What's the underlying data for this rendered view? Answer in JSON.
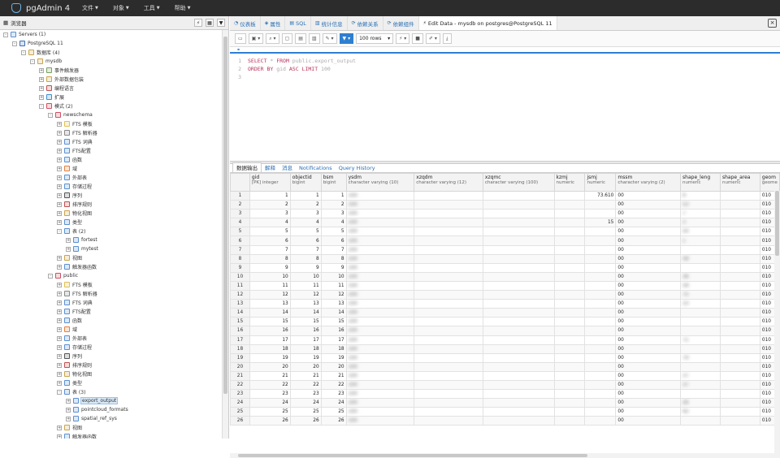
{
  "app": {
    "title": "pgAdmin 4"
  },
  "menu": [
    {
      "label": "文件"
    },
    {
      "label": "对象"
    },
    {
      "label": "工具"
    },
    {
      "label": "帮助"
    }
  ],
  "browser": {
    "title": "浏览器"
  },
  "tree": [
    {
      "level": 0,
      "label": "Servers (1)",
      "color": "#5a8fd0",
      "toggle": "-"
    },
    {
      "level": 1,
      "label": "PostgreSQL 11",
      "color": "#3d6fb5",
      "toggle": "-"
    },
    {
      "level": 2,
      "label": "数据库 (4)",
      "color": "#c9a44a",
      "toggle": "-"
    },
    {
      "level": 3,
      "label": "mysdb",
      "color": "#c9a44a",
      "toggle": "-"
    },
    {
      "level": 4,
      "label": "事件触发器",
      "color": "#7aa060",
      "toggle": "+"
    },
    {
      "level": 4,
      "label": "外部数据包装",
      "color": "#c9a44a",
      "toggle": "+"
    },
    {
      "level": 4,
      "label": "编程语言",
      "color": "#c05050",
      "toggle": "+"
    },
    {
      "level": 4,
      "label": "扩展",
      "color": "#3a8fd0",
      "toggle": "+"
    },
    {
      "level": 4,
      "label": "模式 (2)",
      "color": "#d05060",
      "toggle": "-"
    },
    {
      "level": 5,
      "label": "newschema",
      "color": "#d05060",
      "toggle": "-"
    },
    {
      "level": 6,
      "label": "FTS 模板",
      "color": "#e0c050",
      "toggle": "+"
    },
    {
      "level": 6,
      "label": "FTS 解析器",
      "color": "#888888",
      "toggle": "+"
    },
    {
      "level": 6,
      "label": "FTS 词典",
      "color": "#5a8fd0",
      "toggle": "+"
    },
    {
      "level": 6,
      "label": "FTS配置",
      "color": "#5a8fd0",
      "toggle": "+"
    },
    {
      "level": 6,
      "label": "函数",
      "color": "#5a8fd0",
      "toggle": "+"
    },
    {
      "level": 6,
      "label": "域",
      "color": "#e08040",
      "toggle": "+"
    },
    {
      "level": 6,
      "label": "外部表",
      "color": "#5a8fd0",
      "toggle": "+"
    },
    {
      "level": 6,
      "label": "存储过程",
      "color": "#5a8fd0",
      "toggle": "+"
    },
    {
      "level": 6,
      "label": "序列",
      "color": "#555555",
      "toggle": "+"
    },
    {
      "level": 6,
      "label": "排序规则",
      "color": "#c05050",
      "toggle": "+"
    },
    {
      "level": 6,
      "label": "物化视图",
      "color": "#c9a44a",
      "toggle": "+"
    },
    {
      "level": 6,
      "label": "类型",
      "color": "#5a8fd0",
      "toggle": "+"
    },
    {
      "level": 6,
      "label": "表 (2)",
      "color": "#5a8fd0",
      "toggle": "-"
    },
    {
      "level": 7,
      "label": "fortest",
      "color": "#5a8fd0",
      "toggle": "+"
    },
    {
      "level": 7,
      "label": "mytest",
      "color": "#5a8fd0",
      "toggle": "+"
    },
    {
      "level": 6,
      "label": "视图",
      "color": "#c9a44a",
      "toggle": "+"
    },
    {
      "level": 6,
      "label": "触发器函数",
      "color": "#5a8fd0",
      "toggle": "+"
    },
    {
      "level": 5,
      "label": "public",
      "color": "#d05060",
      "toggle": "-"
    },
    {
      "level": 6,
      "label": "FTS 模板",
      "color": "#e0c050",
      "toggle": "+"
    },
    {
      "level": 6,
      "label": "FTS 解析器",
      "color": "#888888",
      "toggle": "+"
    },
    {
      "level": 6,
      "label": "FTS 词典",
      "color": "#5a8fd0",
      "toggle": "+"
    },
    {
      "level": 6,
      "label": "FTS配置",
      "color": "#5a8fd0",
      "toggle": "+"
    },
    {
      "level": 6,
      "label": "函数",
      "color": "#5a8fd0",
      "toggle": "+"
    },
    {
      "level": 6,
      "label": "域",
      "color": "#e08040",
      "toggle": "+"
    },
    {
      "level": 6,
      "label": "外部表",
      "color": "#5a8fd0",
      "toggle": "+"
    },
    {
      "level": 6,
      "label": "存储过程",
      "color": "#5a8fd0",
      "toggle": "+"
    },
    {
      "level": 6,
      "label": "序列",
      "color": "#555555",
      "toggle": "+"
    },
    {
      "level": 6,
      "label": "排序规则",
      "color": "#c05050",
      "toggle": "+"
    },
    {
      "level": 6,
      "label": "物化视图",
      "color": "#c9a44a",
      "toggle": "+"
    },
    {
      "level": 6,
      "label": "类型",
      "color": "#5a8fd0",
      "toggle": "+"
    },
    {
      "level": 6,
      "label": "表 (3)",
      "color": "#5a8fd0",
      "toggle": "-"
    },
    {
      "level": 7,
      "label": "export_output",
      "color": "#5a8fd0",
      "toggle": "+",
      "selected": true
    },
    {
      "level": 7,
      "label": "pointcloud_formats",
      "color": "#5a8fd0",
      "toggle": "+"
    },
    {
      "level": 7,
      "label": "spatial_ref_sys",
      "color": "#5a8fd0",
      "toggle": "+"
    },
    {
      "level": 6,
      "label": "视图",
      "color": "#c9a44a",
      "toggle": "+"
    },
    {
      "level": 6,
      "label": "触发器函数",
      "color": "#5a8fd0",
      "toggle": "+"
    }
  ],
  "tabs": [
    {
      "label": "仪表板",
      "icon": "◔"
    },
    {
      "label": "属性",
      "icon": "◈"
    },
    {
      "label": "SQL",
      "icon": "▤"
    },
    {
      "label": "统计信息",
      "icon": "▥"
    },
    {
      "label": "依赖关系",
      "icon": "⟳"
    },
    {
      "label": "依赖组件",
      "icon": "⟳"
    },
    {
      "label": "Edit Data - mysdb on postgres@PostgreSQL 11",
      "icon": "⚡",
      "active": true
    }
  ],
  "toolbar": {
    "rows_select": "100 rows"
  },
  "editor": {
    "lines": [
      {
        "n": "1",
        "kw1": "SELECT",
        "t1": " * ",
        "kw2": "FROM",
        "t2": " public.export_output"
      },
      {
        "n": "2",
        "kw1": "ORDER BY",
        "t1": " gid ",
        "kw2": "ASC LIMIT",
        "t2": " 100"
      },
      {
        "n": "3",
        "kw1": "",
        "t1": "",
        "kw2": "",
        "t2": ""
      }
    ]
  },
  "result_tabs": [
    {
      "label": "数据输出",
      "active": true
    },
    {
      "label": "解释"
    },
    {
      "label": "消息"
    },
    {
      "label": "Notifications"
    },
    {
      "label": "Query History"
    }
  ],
  "grid": {
    "columns": [
      {
        "name": "gid",
        "type": "[PK] integer",
        "w": 50
      },
      {
        "name": "objectid",
        "type": "bigint",
        "w": 38
      },
      {
        "name": "bsm",
        "type": "bigint",
        "w": 31
      },
      {
        "name": "ysdm",
        "type": "character varying (10)",
        "w": 84
      },
      {
        "name": "xzqdm",
        "type": "character varying (12)",
        "w": 85
      },
      {
        "name": "xzqmc",
        "type": "character varying (100)",
        "w": 88
      },
      {
        "name": "kzmj",
        "type": "numeric",
        "w": 38
      },
      {
        "name": "jsmj",
        "type": "numeric",
        "w": 38
      },
      {
        "name": "mssm",
        "type": "character varying (2)",
        "w": 80
      },
      {
        "name": "shape_leng",
        "type": "numeric",
        "w": 49
      },
      {
        "name": "shape_area",
        "type": "numeric",
        "w": 49
      },
      {
        "name": "geom",
        "type": "geome",
        "w": 20
      }
    ],
    "rows": [
      [
        "1",
        "1",
        "1",
        "100",
        "",
        "",
        "",
        "73.610",
        "00",
        "9",
        "",
        "010"
      ],
      [
        "2",
        "2",
        "2",
        "100",
        "",
        "",
        "",
        "",
        "00",
        "53",
        "",
        "010"
      ],
      [
        "3",
        "3",
        "3",
        "100",
        "",
        "",
        "",
        "",
        "00",
        "7",
        "",
        "010"
      ],
      [
        "4",
        "4",
        "4",
        "100",
        "",
        "",
        "",
        "15",
        "00",
        "3",
        "",
        "010"
      ],
      [
        "5",
        "5",
        "5",
        "100",
        "",
        "",
        "",
        "",
        "00",
        "50",
        "",
        "010"
      ],
      [
        "6",
        "6",
        "6",
        "100",
        "",
        "",
        "",
        "",
        "00",
        "1",
        "",
        "010"
      ],
      [
        "7",
        "7",
        "7",
        "100",
        "",
        "",
        "",
        "",
        "00",
        "",
        "",
        "010"
      ],
      [
        "8",
        "8",
        "8",
        "100",
        "",
        "",
        "",
        "",
        "00",
        "58",
        "",
        "010"
      ],
      [
        "9",
        "9",
        "9",
        "100",
        "",
        "",
        "",
        "",
        "00",
        "",
        "",
        "010"
      ],
      [
        "10",
        "10",
        "10",
        "100",
        "",
        "",
        "",
        "",
        "00",
        "36",
        "",
        "010"
      ],
      [
        "11",
        "11",
        "11",
        "100",
        "",
        "",
        "",
        "",
        "00",
        "58",
        "",
        "010"
      ],
      [
        "12",
        "12",
        "12",
        "100",
        "",
        "",
        "",
        "",
        "00",
        "75",
        "",
        "010"
      ],
      [
        "13",
        "13",
        "13",
        "100",
        "",
        "",
        "",
        "",
        "00",
        "33",
        "",
        "010"
      ],
      [
        "14",
        "14",
        "14",
        "100",
        "",
        "",
        "",
        "",
        "00",
        "",
        "",
        "010"
      ],
      [
        "15",
        "15",
        "15",
        "100",
        "",
        "",
        "",
        "",
        "00",
        "",
        "",
        "010"
      ],
      [
        "16",
        "16",
        "16",
        "100",
        "",
        "",
        "",
        "",
        "00",
        "",
        "",
        "010"
      ],
      [
        "17",
        "17",
        "17",
        "100",
        "",
        "",
        "",
        "",
        "00",
        "71",
        "",
        "010"
      ],
      [
        "18",
        "18",
        "18",
        "100",
        "",
        "",
        "",
        "",
        "00",
        "",
        "",
        "010"
      ],
      [
        "19",
        "19",
        "19",
        "100",
        "",
        "",
        "",
        "",
        "00",
        "74",
        "",
        "010"
      ],
      [
        "20",
        "20",
        "20",
        "100",
        "",
        "",
        "",
        "",
        "00",
        "",
        "",
        "010"
      ],
      [
        "21",
        "21",
        "21",
        "100",
        "",
        "",
        "",
        "",
        "00",
        "37",
        "",
        "010"
      ],
      [
        "22",
        "22",
        "22",
        "100",
        "",
        "",
        "",
        "",
        "00",
        "37",
        "",
        "010"
      ],
      [
        "23",
        "23",
        "23",
        "100",
        "",
        "",
        "",
        "",
        "00",
        "",
        "",
        "010"
      ],
      [
        "24",
        "24",
        "24",
        "100",
        "",
        "",
        "",
        "",
        "00",
        "26",
        "",
        "010"
      ],
      [
        "25",
        "25",
        "25",
        "100",
        "",
        "",
        "",
        "",
        "00",
        "42",
        "",
        "010"
      ],
      [
        "26",
        "26",
        "26",
        "100",
        "",
        "",
        "",
        "",
        "00",
        "",
        "",
        "010"
      ]
    ]
  },
  "colors": {
    "accent": "#2f7fd1",
    "topbar": "#2c2c2c",
    "keyword": "#b8345a"
  },
  "icons": {
    "search": "search-icon",
    "filter": "filter-icon",
    "close": "close-icon"
  }
}
